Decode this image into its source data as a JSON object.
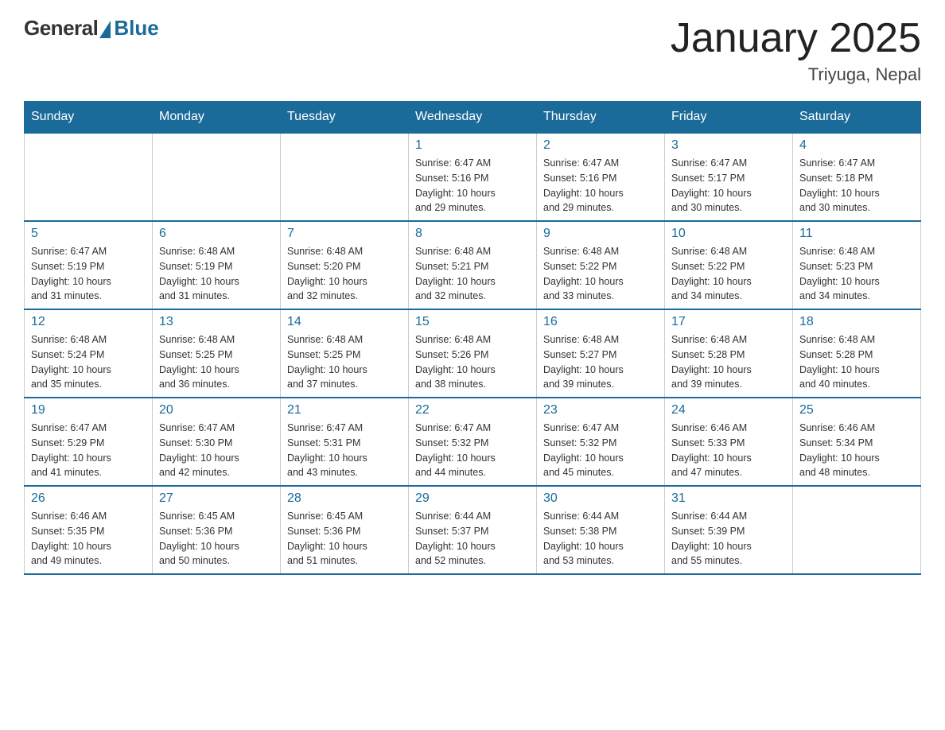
{
  "header": {
    "logo_general": "General",
    "logo_blue": "Blue",
    "title": "January 2025",
    "location": "Triyuga, Nepal"
  },
  "weekdays": [
    "Sunday",
    "Monday",
    "Tuesday",
    "Wednesday",
    "Thursday",
    "Friday",
    "Saturday"
  ],
  "weeks": [
    [
      {
        "day": "",
        "info": ""
      },
      {
        "day": "",
        "info": ""
      },
      {
        "day": "",
        "info": ""
      },
      {
        "day": "1",
        "info": "Sunrise: 6:47 AM\nSunset: 5:16 PM\nDaylight: 10 hours\nand 29 minutes."
      },
      {
        "day": "2",
        "info": "Sunrise: 6:47 AM\nSunset: 5:16 PM\nDaylight: 10 hours\nand 29 minutes."
      },
      {
        "day": "3",
        "info": "Sunrise: 6:47 AM\nSunset: 5:17 PM\nDaylight: 10 hours\nand 30 minutes."
      },
      {
        "day": "4",
        "info": "Sunrise: 6:47 AM\nSunset: 5:18 PM\nDaylight: 10 hours\nand 30 minutes."
      }
    ],
    [
      {
        "day": "5",
        "info": "Sunrise: 6:47 AM\nSunset: 5:19 PM\nDaylight: 10 hours\nand 31 minutes."
      },
      {
        "day": "6",
        "info": "Sunrise: 6:48 AM\nSunset: 5:19 PM\nDaylight: 10 hours\nand 31 minutes."
      },
      {
        "day": "7",
        "info": "Sunrise: 6:48 AM\nSunset: 5:20 PM\nDaylight: 10 hours\nand 32 minutes."
      },
      {
        "day": "8",
        "info": "Sunrise: 6:48 AM\nSunset: 5:21 PM\nDaylight: 10 hours\nand 32 minutes."
      },
      {
        "day": "9",
        "info": "Sunrise: 6:48 AM\nSunset: 5:22 PM\nDaylight: 10 hours\nand 33 minutes."
      },
      {
        "day": "10",
        "info": "Sunrise: 6:48 AM\nSunset: 5:22 PM\nDaylight: 10 hours\nand 34 minutes."
      },
      {
        "day": "11",
        "info": "Sunrise: 6:48 AM\nSunset: 5:23 PM\nDaylight: 10 hours\nand 34 minutes."
      }
    ],
    [
      {
        "day": "12",
        "info": "Sunrise: 6:48 AM\nSunset: 5:24 PM\nDaylight: 10 hours\nand 35 minutes."
      },
      {
        "day": "13",
        "info": "Sunrise: 6:48 AM\nSunset: 5:25 PM\nDaylight: 10 hours\nand 36 minutes."
      },
      {
        "day": "14",
        "info": "Sunrise: 6:48 AM\nSunset: 5:25 PM\nDaylight: 10 hours\nand 37 minutes."
      },
      {
        "day": "15",
        "info": "Sunrise: 6:48 AM\nSunset: 5:26 PM\nDaylight: 10 hours\nand 38 minutes."
      },
      {
        "day": "16",
        "info": "Sunrise: 6:48 AM\nSunset: 5:27 PM\nDaylight: 10 hours\nand 39 minutes."
      },
      {
        "day": "17",
        "info": "Sunrise: 6:48 AM\nSunset: 5:28 PM\nDaylight: 10 hours\nand 39 minutes."
      },
      {
        "day": "18",
        "info": "Sunrise: 6:48 AM\nSunset: 5:28 PM\nDaylight: 10 hours\nand 40 minutes."
      }
    ],
    [
      {
        "day": "19",
        "info": "Sunrise: 6:47 AM\nSunset: 5:29 PM\nDaylight: 10 hours\nand 41 minutes."
      },
      {
        "day": "20",
        "info": "Sunrise: 6:47 AM\nSunset: 5:30 PM\nDaylight: 10 hours\nand 42 minutes."
      },
      {
        "day": "21",
        "info": "Sunrise: 6:47 AM\nSunset: 5:31 PM\nDaylight: 10 hours\nand 43 minutes."
      },
      {
        "day": "22",
        "info": "Sunrise: 6:47 AM\nSunset: 5:32 PM\nDaylight: 10 hours\nand 44 minutes."
      },
      {
        "day": "23",
        "info": "Sunrise: 6:47 AM\nSunset: 5:32 PM\nDaylight: 10 hours\nand 45 minutes."
      },
      {
        "day": "24",
        "info": "Sunrise: 6:46 AM\nSunset: 5:33 PM\nDaylight: 10 hours\nand 47 minutes."
      },
      {
        "day": "25",
        "info": "Sunrise: 6:46 AM\nSunset: 5:34 PM\nDaylight: 10 hours\nand 48 minutes."
      }
    ],
    [
      {
        "day": "26",
        "info": "Sunrise: 6:46 AM\nSunset: 5:35 PM\nDaylight: 10 hours\nand 49 minutes."
      },
      {
        "day": "27",
        "info": "Sunrise: 6:45 AM\nSunset: 5:36 PM\nDaylight: 10 hours\nand 50 minutes."
      },
      {
        "day": "28",
        "info": "Sunrise: 6:45 AM\nSunset: 5:36 PM\nDaylight: 10 hours\nand 51 minutes."
      },
      {
        "day": "29",
        "info": "Sunrise: 6:44 AM\nSunset: 5:37 PM\nDaylight: 10 hours\nand 52 minutes."
      },
      {
        "day": "30",
        "info": "Sunrise: 6:44 AM\nSunset: 5:38 PM\nDaylight: 10 hours\nand 53 minutes."
      },
      {
        "day": "31",
        "info": "Sunrise: 6:44 AM\nSunset: 5:39 PM\nDaylight: 10 hours\nand 55 minutes."
      },
      {
        "day": "",
        "info": ""
      }
    ]
  ]
}
